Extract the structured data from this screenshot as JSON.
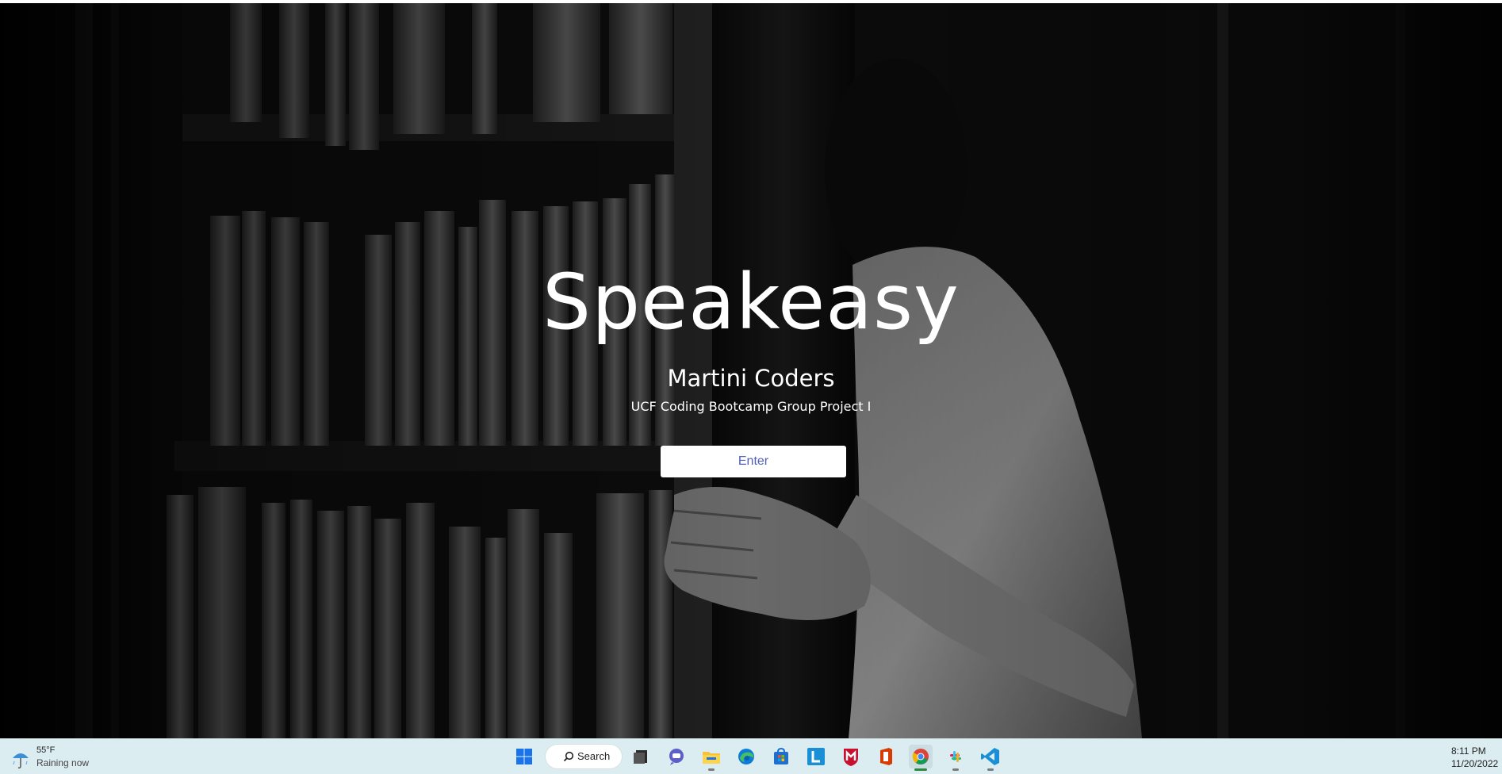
{
  "hero": {
    "title": "Speakeasy",
    "subtitle": "Martini Coders",
    "tagline": "UCF Coding Bootcamp Group Project I",
    "enter_label": "Enter",
    "background_image": "black-and-white photo of a man pushing open a hidden bookshelf door"
  },
  "taskbar": {
    "weather": {
      "temp": "55°F",
      "condition": "Raining now",
      "icon": "rain-umbrella-icon"
    },
    "search_label": "Search",
    "apps": [
      {
        "name": "windows-start-icon"
      },
      {
        "name": "task-view-icon"
      },
      {
        "name": "teams-chat-icon"
      },
      {
        "name": "file-explorer-icon"
      },
      {
        "name": "edge-browser-icon"
      },
      {
        "name": "microsoft-store-icon"
      },
      {
        "name": "l-app-icon"
      },
      {
        "name": "mcafee-icon"
      },
      {
        "name": "office-icon"
      },
      {
        "name": "chrome-icon"
      },
      {
        "name": "slack-icon"
      },
      {
        "name": "vscode-icon"
      }
    ],
    "clock": {
      "time": "8:11 PM",
      "date": "11/20/2022"
    }
  },
  "colors": {
    "button_text": "#5260b8",
    "taskbar_bg": "#dcedf1"
  }
}
